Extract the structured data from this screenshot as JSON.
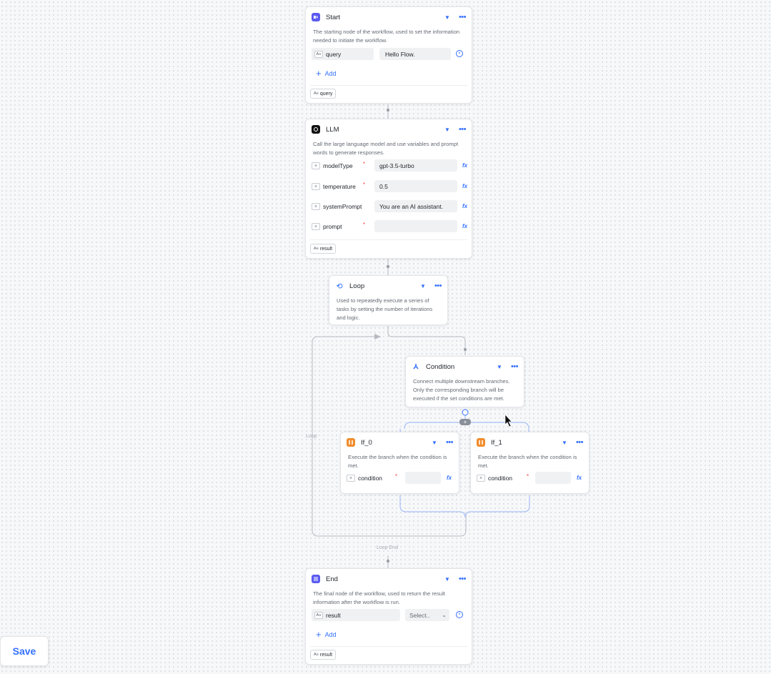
{
  "start": {
    "title": "Start",
    "desc": "The starting node of the workflow, used to set the information needed to initiate the workflow.",
    "var_type": "A≡",
    "var_name": "query",
    "var_value": "Hello Flow.",
    "add_label": "Add",
    "output_type": "A≡",
    "output": "query"
  },
  "llm": {
    "title": "LLM",
    "desc": "Call the large language model and use variables and prompt words to generate responses.",
    "params": [
      {
        "type": "≡",
        "name": "modelType",
        "value": "gpt-3.5-turbo"
      },
      {
        "type": "≡",
        "name": "temperature",
        "value": "0.5"
      },
      {
        "type": "≡",
        "name": "systemPrompt",
        "value": "You are an AI assistant."
      },
      {
        "type": "≡",
        "name": "prompt",
        "value": ""
      }
    ],
    "required_mark": "*",
    "fx": "fx",
    "output_type": "A≡",
    "output": "result"
  },
  "loop": {
    "title": "Loop",
    "desc": "Used to repeatedly execute a series of tasks by setting the number of iterations and logic."
  },
  "condition": {
    "title": "Condition",
    "desc": "Connect multiple downstream branches. Only the corresponding branch will be executed if the set conditions are met."
  },
  "if0": {
    "title": "If_0",
    "desc": "Execute the branch when the condition is met.",
    "param_name": "condition",
    "param_type": "≡",
    "value": ""
  },
  "if1": {
    "title": "If_1",
    "desc": "Execute the branch when the condition is met.",
    "param_name": "condition",
    "param_type": "≡",
    "value": ""
  },
  "edges": {
    "loop_label": "Loop",
    "loop_end_label": "Loop End"
  },
  "end": {
    "title": "End",
    "desc": "The final node of the workflow, used to return the result information after the workflow is run.",
    "var_type": "A≡",
    "var_name": "result",
    "select_placeholder": "Select..",
    "add_label": "Add",
    "output_type": "A≡",
    "output": "result"
  },
  "save_label": "Save",
  "colors": {
    "accent": "#3370ff",
    "start_icon": "#5b5bf0",
    "if_icon": "#f08c2b",
    "required": "#f54a45"
  }
}
